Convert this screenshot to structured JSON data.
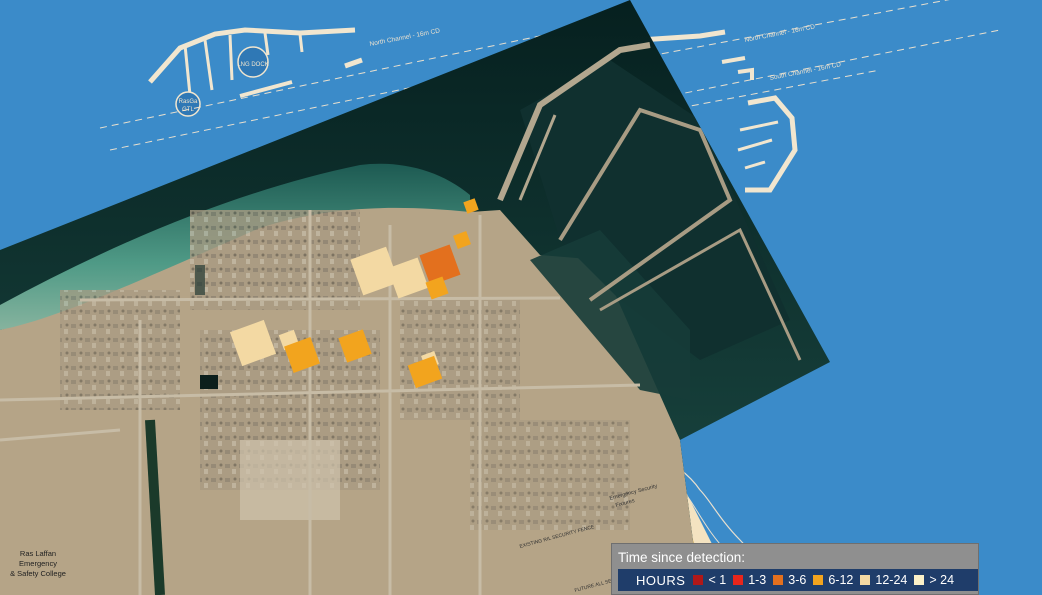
{
  "map": {
    "labels": {
      "lng_dock": "LNG DOCK",
      "rasgas_gtl_1": "RasGa",
      "rasgas_gtl_2": "GTL",
      "north_channel_left": "North Channel - 16m CD",
      "north_channel_right": "North Channel - 16m CD",
      "south_channel": "South Channel - 16m CD",
      "ras_laffan_1": "Ras Laffan",
      "ras_laffan_2": "Emergency",
      "ras_laffan_3": "& Safety College",
      "emergency_fixtures_1": "Emergency Security",
      "emergency_fixtures_2": "Fixtures",
      "security_fence": "EXISTING RIL SECURITY FENCE",
      "future_fence": "FUTURE ALL SEC"
    },
    "colors": {
      "sea": "#3b8bc9",
      "satellite_water": "#0e2a2c",
      "land": "#b5a487",
      "plan_fill": "#f4e3c1",
      "yard": "#f5c842"
    }
  },
  "legend": {
    "title": "Time since detection:",
    "units": "HOURS",
    "items": [
      {
        "label": "< 1",
        "color": "#b01818"
      },
      {
        "label": "1-3",
        "color": "#e8261c"
      },
      {
        "label": "3-6",
        "color": "#e3701e"
      },
      {
        "label": "6-12",
        "color": "#f2a41e"
      },
      {
        "label": "12-24",
        "color": "#f3d9a3"
      },
      {
        "label": "> 24",
        "color": "#faf0c8"
      }
    ]
  }
}
